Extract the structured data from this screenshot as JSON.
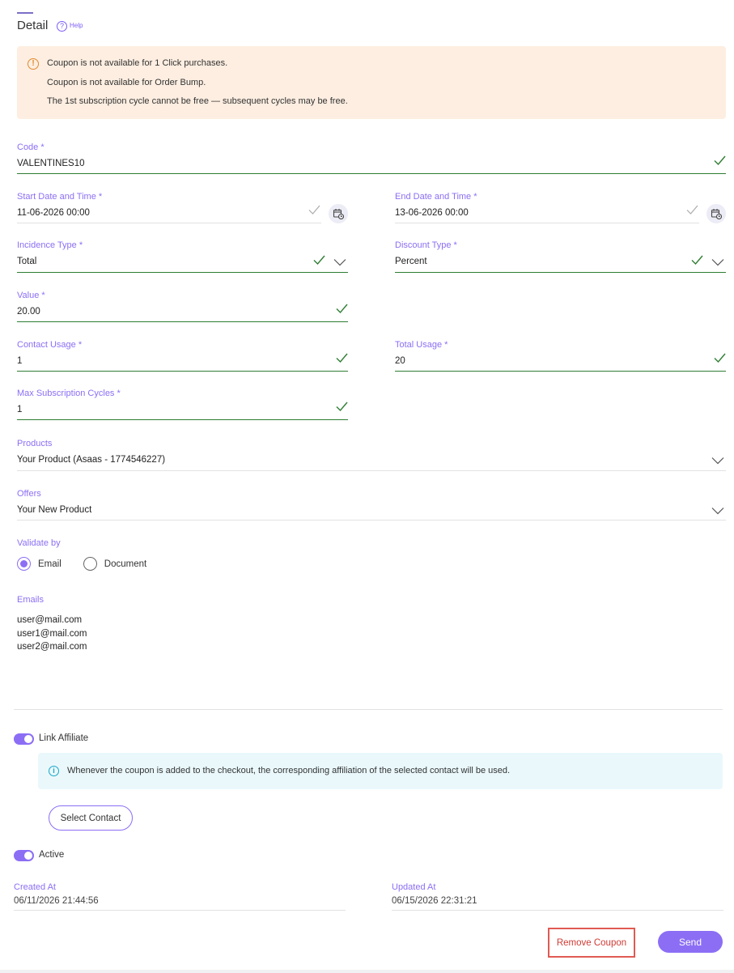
{
  "header": {
    "title": "Detail",
    "help_label": "Help",
    "help_glyph": "?"
  },
  "alerts": {
    "warning_lines": [
      "Coupon is not available for 1 Click purchases.",
      "Coupon is not available for Order Bump.",
      "The 1st subscription cycle cannot be free — subsequent cycles may be free."
    ],
    "info_text": "Whenever the coupon is added to the checkout, the corresponding affiliation of the selected contact will be used."
  },
  "form": {
    "code": {
      "label": "Code *",
      "value": "VALENTINES10"
    },
    "start": {
      "label": "Start Date and Time *",
      "value": "11-06-2026 00:00"
    },
    "end": {
      "label": "End Date and Time *",
      "value": "13-06-2026 00:00"
    },
    "incidence": {
      "label": "Incidence Type *",
      "value": "Total"
    },
    "discount": {
      "label": "Discount Type *",
      "value": "Percent"
    },
    "value": {
      "label": "Value *",
      "value": "20.00"
    },
    "contact_usage": {
      "label": "Contact Usage *",
      "value": "1"
    },
    "total_usage": {
      "label": "Total Usage *",
      "value": "20"
    },
    "max_cycles": {
      "label": "Max Subscription Cycles *",
      "value": "1"
    },
    "products": {
      "label": "Products",
      "value": "Your Product (Asaas - 1774546227)"
    },
    "offers": {
      "label": "Offers",
      "value": "Your New Product"
    },
    "validate_by": {
      "label": "Validate by",
      "options": [
        "Email",
        "Document"
      ],
      "selected": "Email"
    },
    "emails": {
      "label": "Emails",
      "list": [
        "user@mail.com",
        "user1@mail.com",
        "user2@mail.com"
      ]
    },
    "link_affiliate": {
      "label": "Link Affiliate",
      "enabled": true
    },
    "select_contact_label": "Select Contact",
    "active": {
      "label": "Active",
      "enabled": true
    },
    "created_at": {
      "label": "Created At",
      "value": "06/11/2026 21:44:56"
    },
    "updated_at": {
      "label": "Updated At",
      "value": "06/15/2026 22:31:21"
    }
  },
  "actions": {
    "remove_label": "Remove Coupon",
    "send_label": "Send"
  },
  "colors": {
    "accent": "#8c6ef5",
    "valid": "#2e7d32",
    "warning_bg": "#fdeee1",
    "info_bg": "#eaf8fc",
    "danger": "#cf3b34"
  },
  "icons": {
    "warning": "warning-circle-icon",
    "info": "info-circle-icon",
    "valid": "check-icon",
    "dropdown": "chevron-down-icon",
    "calendar": "calendar-clock-icon"
  }
}
